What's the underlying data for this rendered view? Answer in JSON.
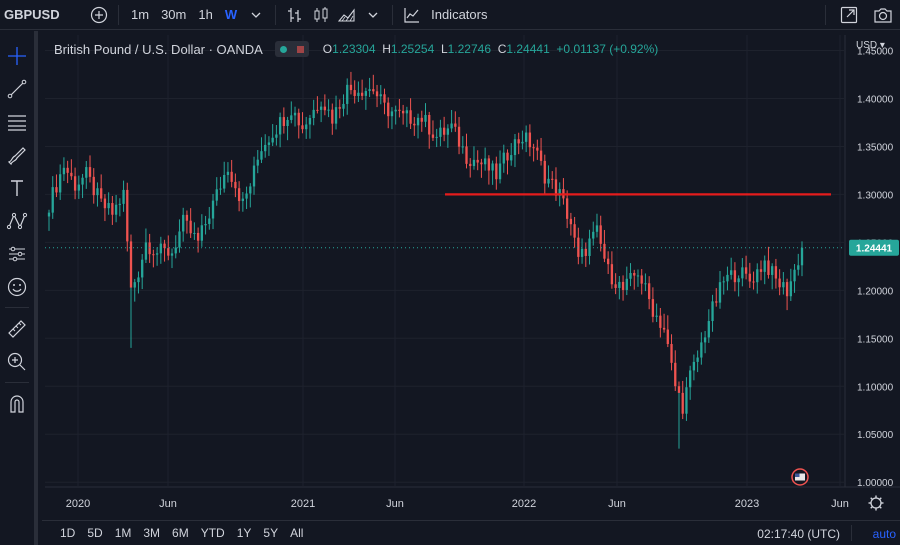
{
  "toolbar": {
    "symbol": "GBPUSD",
    "intervals": [
      "1m",
      "30m",
      "1h",
      "W"
    ],
    "active_interval": "W",
    "indicators_label": "Indicators"
  },
  "legend": {
    "title": "British Pound / U.S. Dollar · OANDA",
    "o_label": "O",
    "o_value": "1.23304",
    "h_label": "H",
    "h_value": "1.25254",
    "l_label": "L",
    "l_value": "1.22746",
    "c_label": "C",
    "c_value": "1.24441",
    "change": "+0.01137 (+0.92%)"
  },
  "currency": "USD",
  "colors": {
    "up": "#26a69a",
    "down": "#ef5350",
    "hline": "#e51c1c",
    "price_tag": "#26a69a",
    "accent": "#2962ff"
  },
  "chart_data": {
    "type": "candlestick",
    "y_ticks": [
      "1.00000",
      "1.05000",
      "1.10000",
      "1.15000",
      "1.20000",
      "1.25000",
      "1.30000",
      "1.35000",
      "1.40000",
      "1.45000"
    ],
    "x_ticks": [
      "2020",
      "Jun",
      "2021",
      "Jun",
      "2022",
      "Jun",
      "2023",
      "Jun"
    ],
    "ylim": [
      1.0,
      1.45
    ],
    "last_price": "1.24441",
    "horizontal_line": 1.3,
    "anchors": [
      {
        "t": 0,
        "v": 1.29
      },
      {
        "t": 4,
        "v": 1.33
      },
      {
        "t": 7,
        "v": 1.31
      },
      {
        "t": 10,
        "v": 1.32
      },
      {
        "t": 14,
        "v": 1.29
      },
      {
        "t": 17,
        "v": 1.28
      },
      {
        "t": 20,
        "v": 1.3
      },
      {
        "t": 22,
        "v": 1.2
      },
      {
        "t": 24,
        "v": 1.22
      },
      {
        "t": 26,
        "v": 1.25
      },
      {
        "t": 29,
        "v": 1.24
      },
      {
        "t": 33,
        "v": 1.24
      },
      {
        "t": 36,
        "v": 1.27
      },
      {
        "t": 40,
        "v": 1.25
      },
      {
        "t": 44,
        "v": 1.29
      },
      {
        "t": 48,
        "v": 1.33
      },
      {
        "t": 52,
        "v": 1.29
      },
      {
        "t": 54,
        "v": 1.31
      },
      {
        "t": 57,
        "v": 1.35
      },
      {
        "t": 61,
        "v": 1.37
      },
      {
        "t": 65,
        "v": 1.39
      },
      {
        "t": 68,
        "v": 1.37
      },
      {
        "t": 73,
        "v": 1.4
      },
      {
        "t": 76,
        "v": 1.38
      },
      {
        "t": 80,
        "v": 1.41
      },
      {
        "t": 84,
        "v": 1.41
      },
      {
        "t": 87,
        "v": 1.41
      },
      {
        "t": 90,
        "v": 1.39
      },
      {
        "t": 95,
        "v": 1.38
      },
      {
        "t": 100,
        "v": 1.38
      },
      {
        "t": 104,
        "v": 1.36
      },
      {
        "t": 108,
        "v": 1.37
      },
      {
        "t": 112,
        "v": 1.34
      },
      {
        "t": 117,
        "v": 1.33
      },
      {
        "t": 120,
        "v": 1.32
      },
      {
        "t": 124,
        "v": 1.35
      },
      {
        "t": 127,
        "v": 1.36
      },
      {
        "t": 130,
        "v": 1.35
      },
      {
        "t": 133,
        "v": 1.32
      },
      {
        "t": 137,
        "v": 1.3
      },
      {
        "t": 140,
        "v": 1.27
      },
      {
        "t": 142,
        "v": 1.23
      },
      {
        "t": 145,
        "v": 1.25
      },
      {
        "t": 147,
        "v": 1.26
      },
      {
        "t": 150,
        "v": 1.22
      },
      {
        "t": 154,
        "v": 1.2
      },
      {
        "t": 158,
        "v": 1.22
      },
      {
        "t": 162,
        "v": 1.18
      },
      {
        "t": 165,
        "v": 1.16
      },
      {
        "t": 168,
        "v": 1.1
      },
      {
        "t": 170,
        "v": 1.08
      },
      {
        "t": 172,
        "v": 1.11
      },
      {
        "t": 174,
        "v": 1.13
      },
      {
        "t": 177,
        "v": 1.17
      },
      {
        "t": 181,
        "v": 1.21
      },
      {
        "t": 185,
        "v": 1.22
      },
      {
        "t": 188,
        "v": 1.21
      },
      {
        "t": 192,
        "v": 1.23
      },
      {
        "t": 195,
        "v": 1.21
      },
      {
        "t": 198,
        "v": 1.2
      },
      {
        "t": 200,
        "v": 1.22
      },
      {
        "t": 202,
        "v": 1.244
      }
    ]
  },
  "bottom": {
    "ranges": [
      "1D",
      "5D",
      "1M",
      "3M",
      "6M",
      "YTD",
      "1Y",
      "5Y",
      "All"
    ],
    "clock": "02:17:40 (UTC)",
    "auto_label": "auto"
  }
}
